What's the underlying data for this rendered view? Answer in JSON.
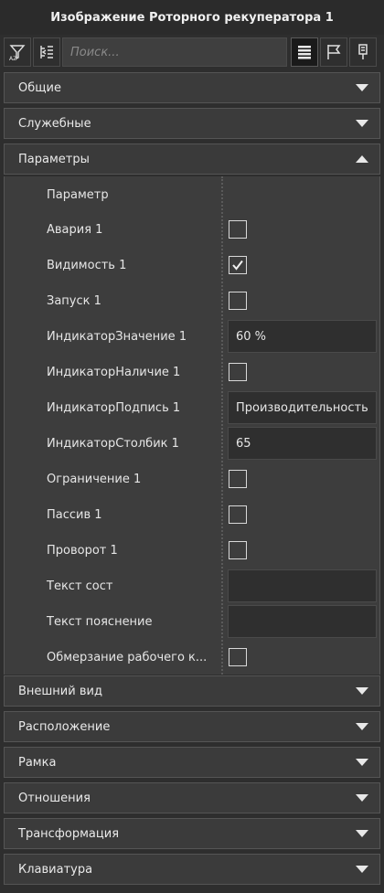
{
  "window": {
    "title": "Изображение Роторного рекуператора 1"
  },
  "toolbar": {
    "buttons": [
      {
        "icon": "sort-filter-icon"
      },
      {
        "icon": "collapse-tree-icon"
      },
      {
        "icon": "list-view-icon",
        "active": true
      },
      {
        "icon": "flag-icon"
      },
      {
        "icon": "pin-icon"
      }
    ],
    "search_placeholder": "Поиск...",
    "search_value": ""
  },
  "sections_top": [
    {
      "label": "Общие",
      "expanded": false
    },
    {
      "label": "Служебные",
      "expanded": false
    },
    {
      "label": "Параметры",
      "expanded": true
    }
  ],
  "params": {
    "header": "Параметр",
    "rows": [
      {
        "name": "Авария 1",
        "type": "checkbox",
        "checked": false
      },
      {
        "name": "Видимость 1",
        "type": "checkbox",
        "checked": true
      },
      {
        "name": "Запуск 1",
        "type": "checkbox",
        "checked": false
      },
      {
        "name": "ИндикаторЗначение 1",
        "type": "text",
        "value": "60 %"
      },
      {
        "name": "ИндикаторНаличие 1",
        "type": "checkbox",
        "checked": false
      },
      {
        "name": "ИндикаторПодпись 1",
        "type": "text",
        "value": "Производительность"
      },
      {
        "name": "ИндикаторСтолбик 1",
        "type": "text",
        "value": "65"
      },
      {
        "name": "Ограничение 1",
        "type": "checkbox",
        "checked": false
      },
      {
        "name": "Пассив 1",
        "type": "checkbox",
        "checked": false
      },
      {
        "name": "Проворот 1",
        "type": "checkbox",
        "checked": false
      },
      {
        "name": "Текст сост",
        "type": "text",
        "value": ""
      },
      {
        "name": "Текст пояснение",
        "type": "text",
        "value": ""
      },
      {
        "name": "Обмерзание рабочего к...",
        "type": "checkbox",
        "checked": false
      }
    ]
  },
  "sections_bottom": [
    {
      "label": "Внешний вид",
      "expanded": false
    },
    {
      "label": "Расположение",
      "expanded": false
    },
    {
      "label": "Рамка",
      "expanded": false
    },
    {
      "label": "Отношения",
      "expanded": false
    },
    {
      "label": "Трансформация",
      "expanded": false
    },
    {
      "label": "Клавиатура",
      "expanded": false
    }
  ],
  "colors": {
    "background": "#2e2e2e",
    "section": "#3b3b3b",
    "field": "#2f2f2f",
    "text": "#e6e6e6"
  }
}
